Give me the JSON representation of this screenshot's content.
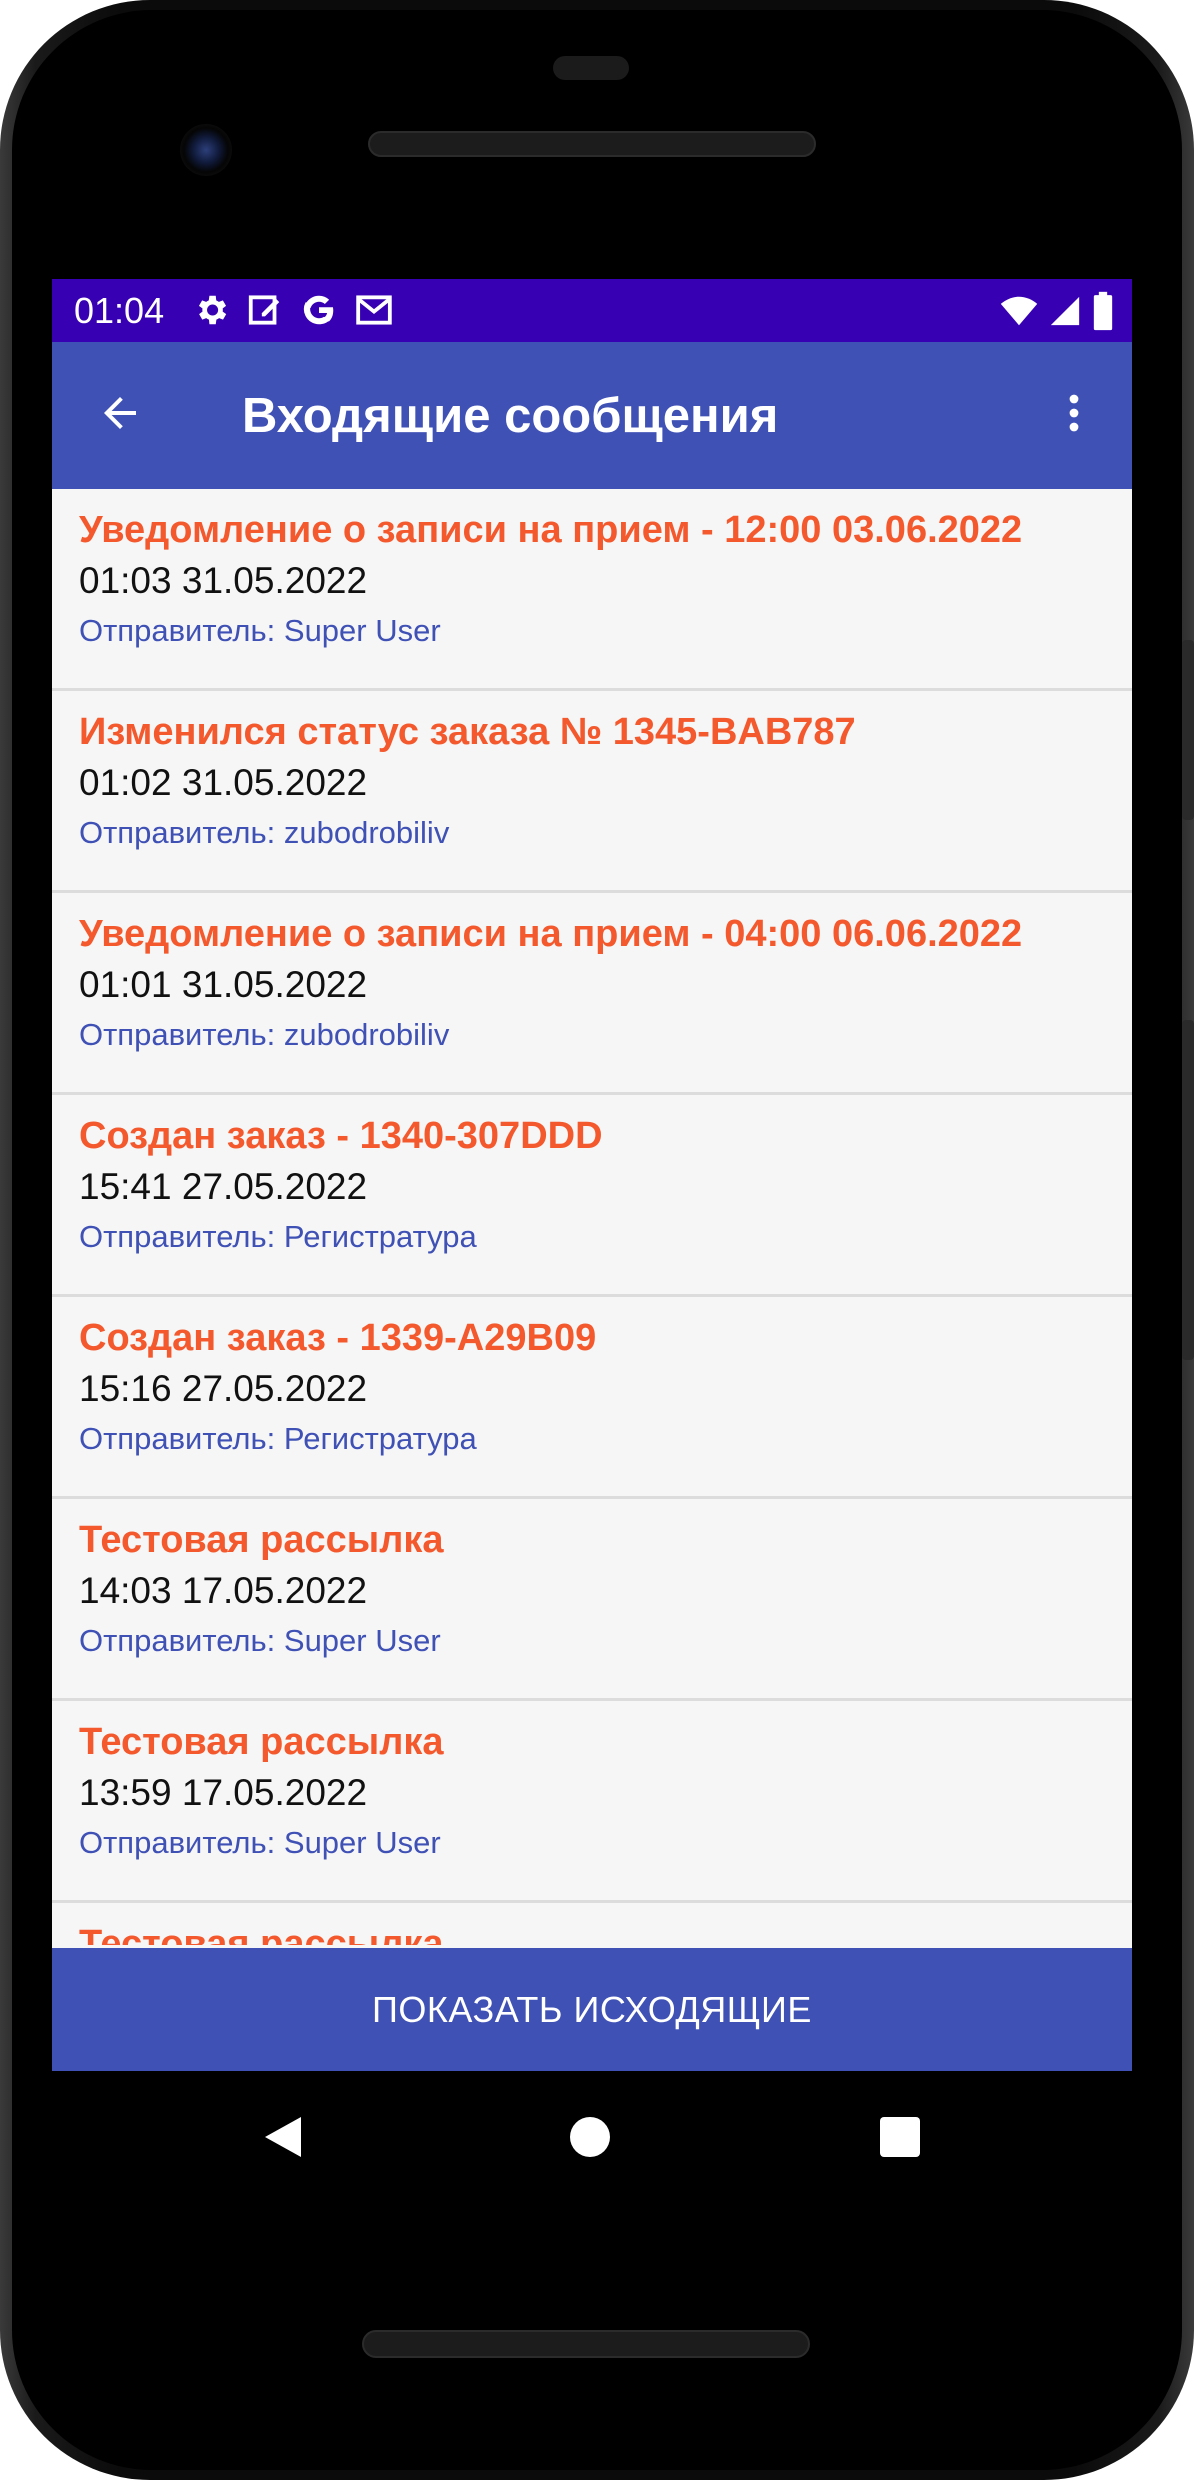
{
  "status_bar": {
    "time": "01:04",
    "left_icons": [
      "gear-icon",
      "edit-note-icon",
      "google-icon",
      "gmail-icon"
    ],
    "right_icons": [
      "wifi-icon",
      "signal-icon",
      "battery-icon"
    ],
    "color": "#3700b3"
  },
  "app_bar": {
    "title": "Входящие сообщения",
    "back_icon": "arrow-left-icon",
    "menu_icon": "more-vert-icon",
    "color": "#3f51b5"
  },
  "messages": [
    {
      "title": "Уведомление о записи на прием - 12:00 03.06.2022",
      "date": "01:03 31.05.2022",
      "sender": "Отправитель: Super User"
    },
    {
      "title": "Изменился статус заказа № 1345-BAB787",
      "date": "01:02 31.05.2022",
      "sender": "Отправитель: zubodrobiliv"
    },
    {
      "title": "Уведомление о записи на прием - 04:00 06.06.2022",
      "date": "01:01 31.05.2022",
      "sender": "Отправитель: zubodrobiliv"
    },
    {
      "title": "Создан заказ - 1340-307DDD",
      "date": "15:41 27.05.2022",
      "sender": "Отправитель: Регистратура"
    },
    {
      "title": "Создан заказ - 1339-A29B09",
      "date": "15:16 27.05.2022",
      "sender": "Отправитель: Регистратура"
    },
    {
      "title": "Тестовая рассылка",
      "date": "14:03 17.05.2022",
      "sender": "Отправитель: Super User"
    },
    {
      "title": "Тестовая рассылка",
      "date": "13:59 17.05.2022",
      "sender": "Отправитель: Super User"
    },
    {
      "title": "Тестовая рассылка",
      "date": "",
      "sender": ""
    }
  ],
  "bottom_button": {
    "label": "ПОКАЗАТЬ ИСХОДЯЩИЕ"
  },
  "nav_bar": {
    "icons": [
      "nav-back-icon",
      "nav-home-icon",
      "nav-recents-icon"
    ]
  },
  "colors": {
    "accent_title": "#f4592e",
    "sender_text": "#3f51b5",
    "primary": "#3f51b5",
    "primary_dark": "#3700b3"
  }
}
